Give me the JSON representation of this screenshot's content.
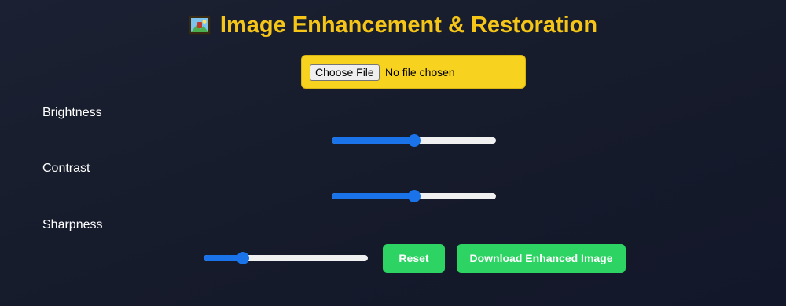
{
  "header": {
    "title": "Image Enhancement & Restoration",
    "icon": "framed-picture-icon"
  },
  "upload": {
    "button_label": "Choose File",
    "status": "No file chosen"
  },
  "controls": {
    "brightness": {
      "label": "Brightness",
      "value_fraction": 0.5
    },
    "contrast": {
      "label": "Contrast",
      "value_fraction": 0.5
    },
    "sharpness": {
      "label": "Sharpness",
      "value_fraction": 0.22
    }
  },
  "actions": {
    "reset_label": "Reset",
    "download_label": "Download Enhanced Image"
  },
  "colors": {
    "accent_yellow": "#f5c518",
    "upload_bg": "#f7d21e",
    "button_green": "#2ed463",
    "slider_blue": "#1a73e8",
    "background": "#161b2b"
  }
}
